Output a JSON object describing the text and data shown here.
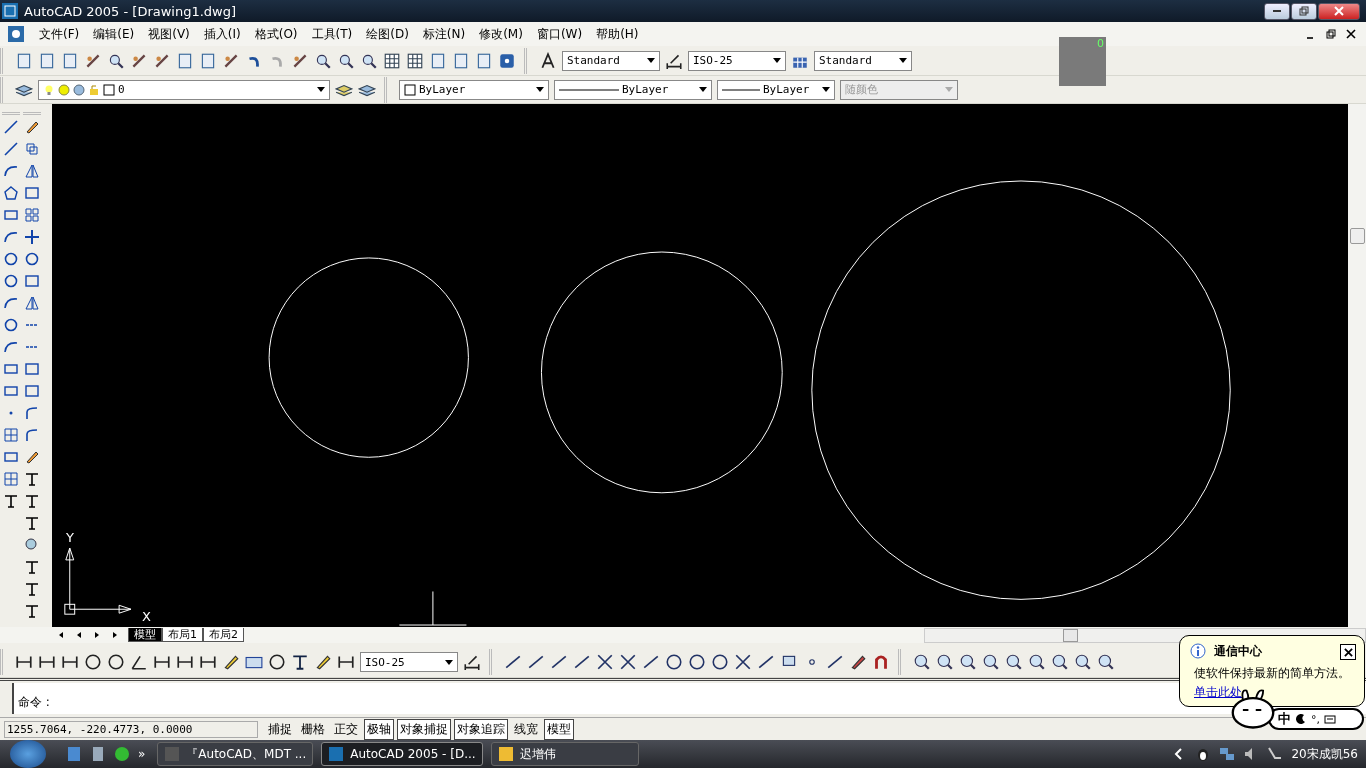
{
  "window": {
    "title": "AutoCAD 2005 - [Drawing1.dwg]"
  },
  "menu": [
    {
      "label": "文件(F)"
    },
    {
      "label": "编辑(E)"
    },
    {
      "label": "视图(V)"
    },
    {
      "label": "插入(I)"
    },
    {
      "label": "格式(O)"
    },
    {
      "label": "工具(T)"
    },
    {
      "label": "绘图(D)"
    },
    {
      "label": "标注(N)"
    },
    {
      "label": "修改(M)"
    },
    {
      "label": "窗口(W)"
    },
    {
      "label": "帮助(H)"
    }
  ],
  "styles": {
    "text_style": "Standard",
    "dim_style": "ISO-25",
    "table_style": "Standard"
  },
  "preview": {
    "label": "0"
  },
  "properties": {
    "layer": "0",
    "color_control": "ByLayer",
    "linetype": "ByLayer",
    "lineweight": "ByLayer",
    "plot_style": {
      "value": "随颜色",
      "disabled": true
    }
  },
  "canvas": {
    "ucs_y": "Y",
    "ucs_x": "X"
  },
  "layout_tabs": [
    {
      "label": "模型",
      "selected": true
    },
    {
      "label": "布局1",
      "selected": false
    },
    {
      "label": "布局2",
      "selected": false
    }
  ],
  "dim_toolbar": {
    "dim_style": "ISO-25"
  },
  "command": {
    "prompt": "命令 :"
  },
  "status_bar": {
    "coordinates": "1255.7064, -220.4773, 0.0000",
    "toggles": [
      {
        "label": "捕捉",
        "on": false
      },
      {
        "label": "栅格",
        "on": false
      },
      {
        "label": "正交",
        "on": false
      },
      {
        "label": "极轴",
        "on": true
      },
      {
        "label": "对象捕捉",
        "on": true
      },
      {
        "label": "对象追踪",
        "on": true
      },
      {
        "label": "线宽",
        "on": false
      },
      {
        "label": "模型",
        "on": true
      }
    ]
  },
  "notification": {
    "title": "通信中心",
    "text": "使软件保持最新的简单方法。",
    "link": "单击此处"
  },
  "ime": {
    "mode": "中",
    "punct": "°,"
  },
  "taskbar": {
    "more": "»",
    "items": [
      {
        "label": "『AutoCAD、MDT ...",
        "selected": false
      },
      {
        "label": "AutoCAD 2005 - [D...",
        "selected": true
      },
      {
        "label": "迟增伟",
        "selected": false
      }
    ],
    "clock": "20宋成凯56"
  }
}
